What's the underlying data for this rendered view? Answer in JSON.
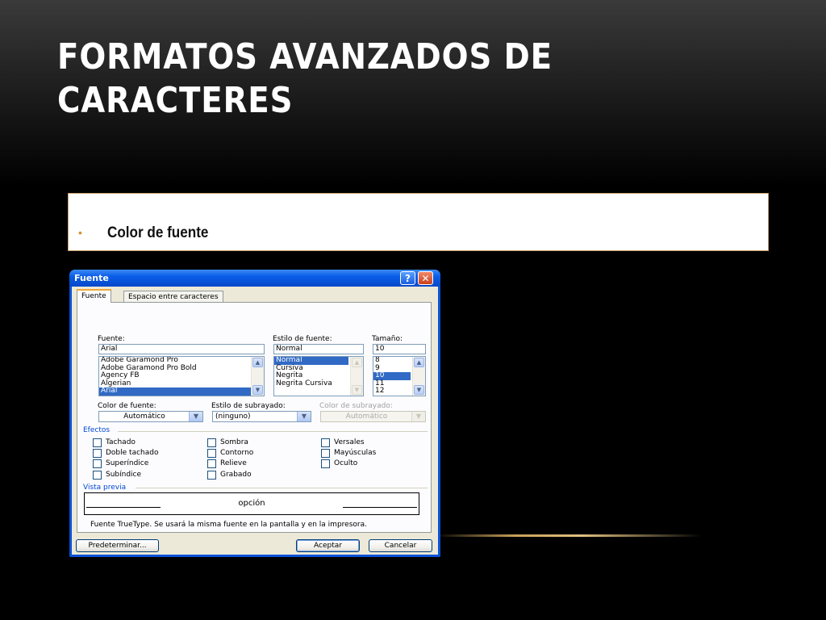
{
  "slide": {
    "title": "FORMATOS AVANZADOS DE CARACTERES",
    "bullet": "Color de fuente"
  },
  "dialog": {
    "title": "Fuente",
    "tabs": [
      "Fuente",
      "Espacio entre caracteres"
    ],
    "font": {
      "label": "Fuente:",
      "value": "Arial",
      "items": [
        "Adobe Garamond Pro",
        "Adobe Garamond Pro Bold",
        "Agency FB",
        "Algerian",
        "Arial"
      ],
      "selected": "Arial"
    },
    "style": {
      "label": "Estilo de fuente:",
      "value": "Normal",
      "items": [
        "Normal",
        "Cursiva",
        "Negrita",
        "Negrita Cursiva"
      ],
      "selected": "Normal"
    },
    "size": {
      "label": "Tamaño:",
      "value": "10",
      "items": [
        "8",
        "9",
        "10",
        "11",
        "12"
      ],
      "selected": "10"
    },
    "color": {
      "label": "Color de fuente:",
      "value": "Automático"
    },
    "underline_style": {
      "label": "Estilo de subrayado:",
      "value": "(ninguno)"
    },
    "underline_color": {
      "label": "Color de subrayado:",
      "value": "Automático"
    },
    "effects": {
      "label": "Efectos",
      "col1": [
        "Tachado",
        "Doble tachado",
        "Superíndice",
        "Subíndice"
      ],
      "col2": [
        "Sombra",
        "Contorno",
        "Relieve",
        "Grabado"
      ],
      "col3": [
        "Versales",
        "Mayúsculas",
        "Oculto"
      ]
    },
    "preview": {
      "label": "Vista previa",
      "sample": "opción",
      "note": "Fuente TrueType. Se usará la misma fuente en la pantalla y en la impresora."
    },
    "buttons": {
      "default": "Predeterminar...",
      "ok": "Aceptar",
      "cancel": "Cancelar"
    }
  }
}
